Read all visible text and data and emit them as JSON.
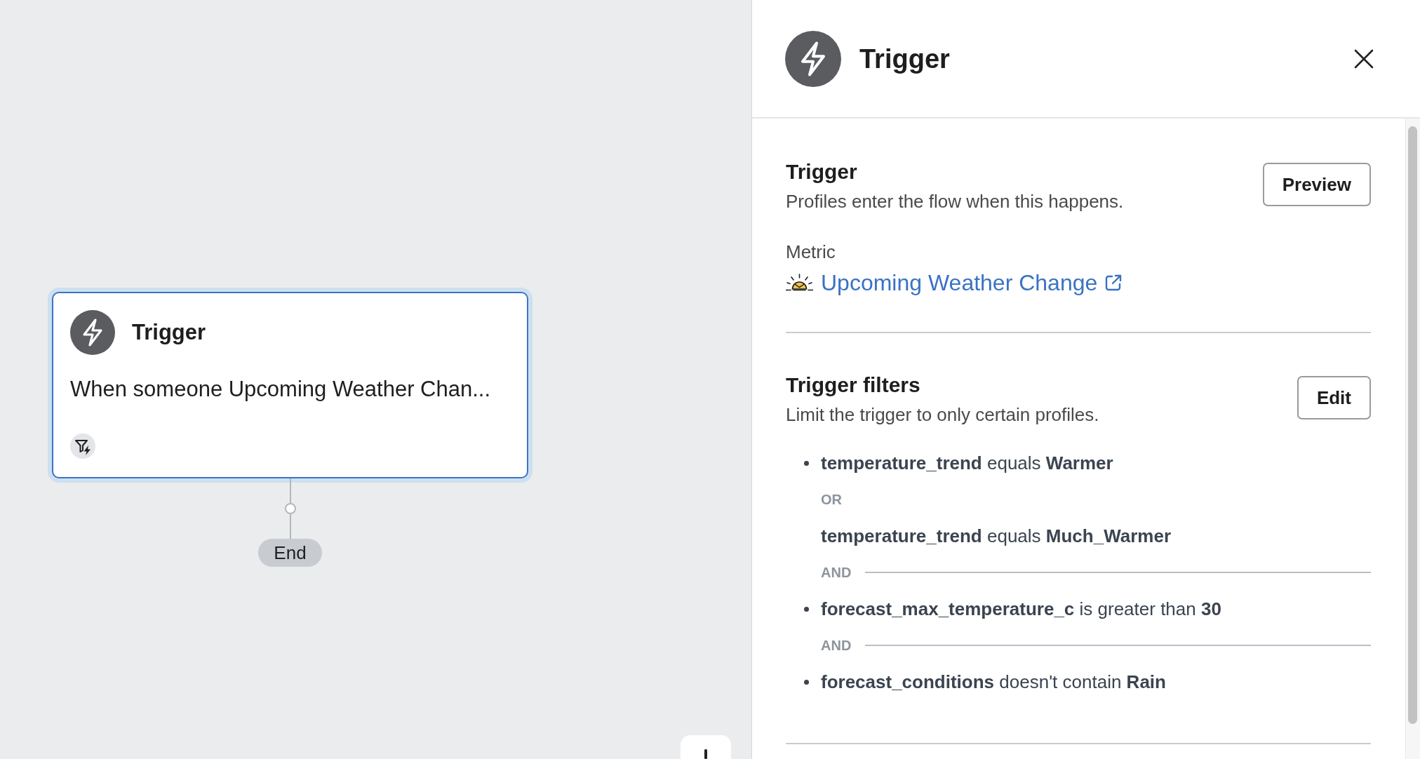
{
  "canvas": {
    "nodes": [
      {
        "kind": "trigger",
        "title": "Trigger",
        "description": "When someone Upcoming Weather Chan...",
        "selected": true,
        "filtered": true
      }
    ],
    "end_label": "End"
  },
  "panel": {
    "title": "Trigger",
    "trigger": {
      "heading": "Trigger",
      "description": "Profiles enter the flow when this happens.",
      "button": "Preview",
      "metric_label": "Metric",
      "metric": "Upcoming Weather Change"
    },
    "filters": {
      "heading": "Trigger filters",
      "description": "Limit the trigger to only certain profiles.",
      "button": "Edit",
      "items": [
        {
          "kind": "condition",
          "text": "**temperature_trend** equals **Warmer**"
        },
        {
          "kind": "or",
          "label": "OR"
        },
        {
          "kind": "condition",
          "text": "**temperature_trend** equals **Much_Warmer**"
        },
        {
          "kind": "and",
          "label": "AND"
        },
        {
          "kind": "condition",
          "text": "**forecast_max_temperature_c** is greater than **30**"
        },
        {
          "kind": "and",
          "label": "AND"
        },
        {
          "kind": "condition",
          "text": "**forecast_conditions** doesn't contain **Rain**"
        }
      ]
    }
  }
}
